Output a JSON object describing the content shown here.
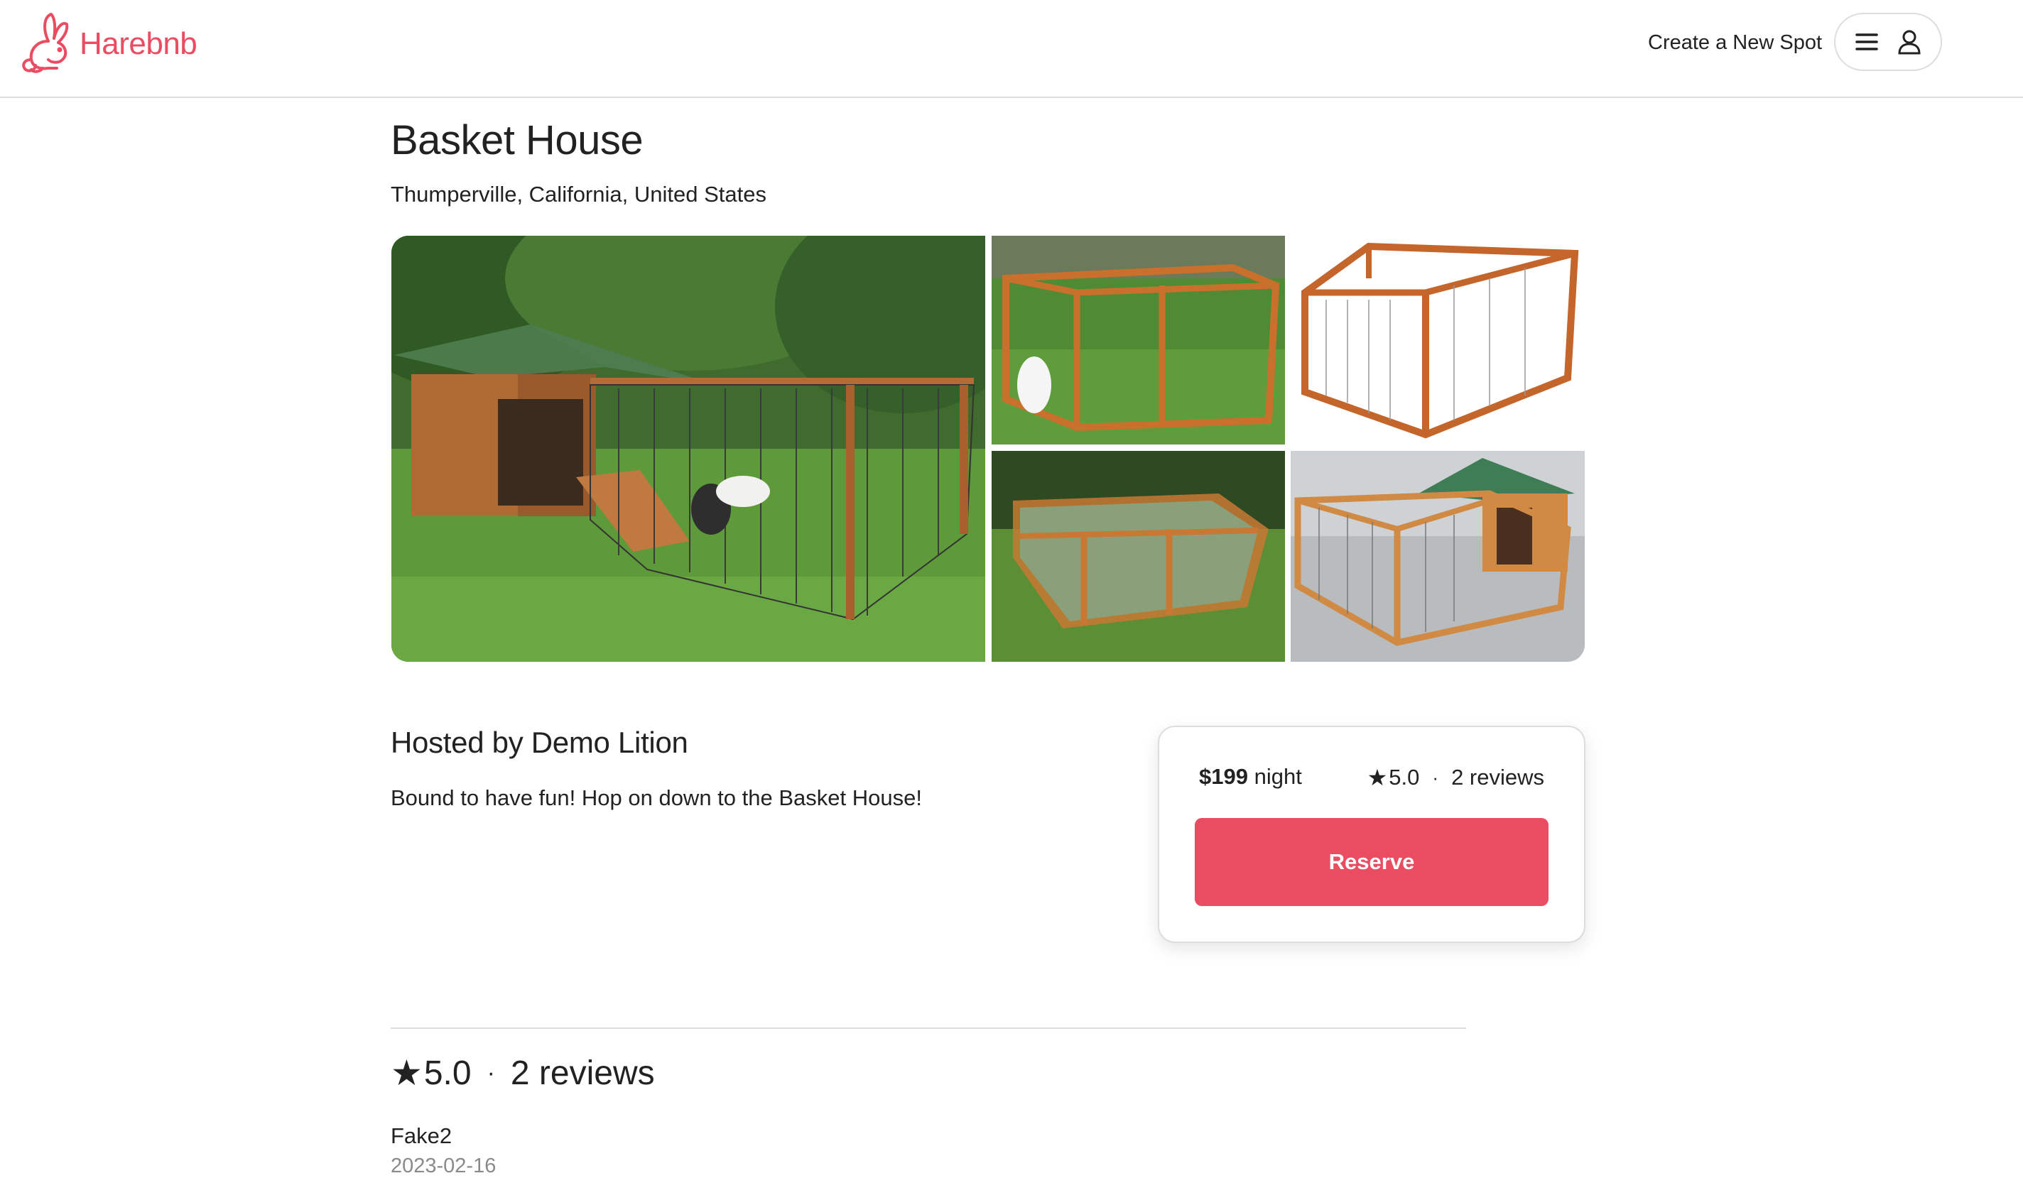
{
  "brand": {
    "name": "Harebnb",
    "accent_color": "#ea4c62"
  },
  "nav": {
    "create_spot_label": "Create a New Spot",
    "menu_icon": "hamburger-menu-icon",
    "user_icon": "user-icon"
  },
  "spot": {
    "name": "Basket House",
    "location": "Thumperville, California, United States",
    "host_heading": "Hosted by Demo Lition",
    "description": "Bound to have fun! Hop on down to the Basket House!",
    "images": [
      {
        "name": "main-photo"
      },
      {
        "name": "photo-2"
      },
      {
        "name": "photo-3"
      },
      {
        "name": "photo-4"
      },
      {
        "name": "photo-5"
      }
    ]
  },
  "booking": {
    "price": "$199",
    "price_unit": "night",
    "star": "★",
    "rating": "5.0",
    "dot": "·",
    "review_count": "2 reviews",
    "reserve_label": "Reserve"
  },
  "reviews": {
    "star": "★",
    "rating": "5.0",
    "dot": "·",
    "count_label": "2 reviews",
    "items": [
      {
        "author": "Fake2",
        "date": "2023-02-16"
      }
    ]
  }
}
